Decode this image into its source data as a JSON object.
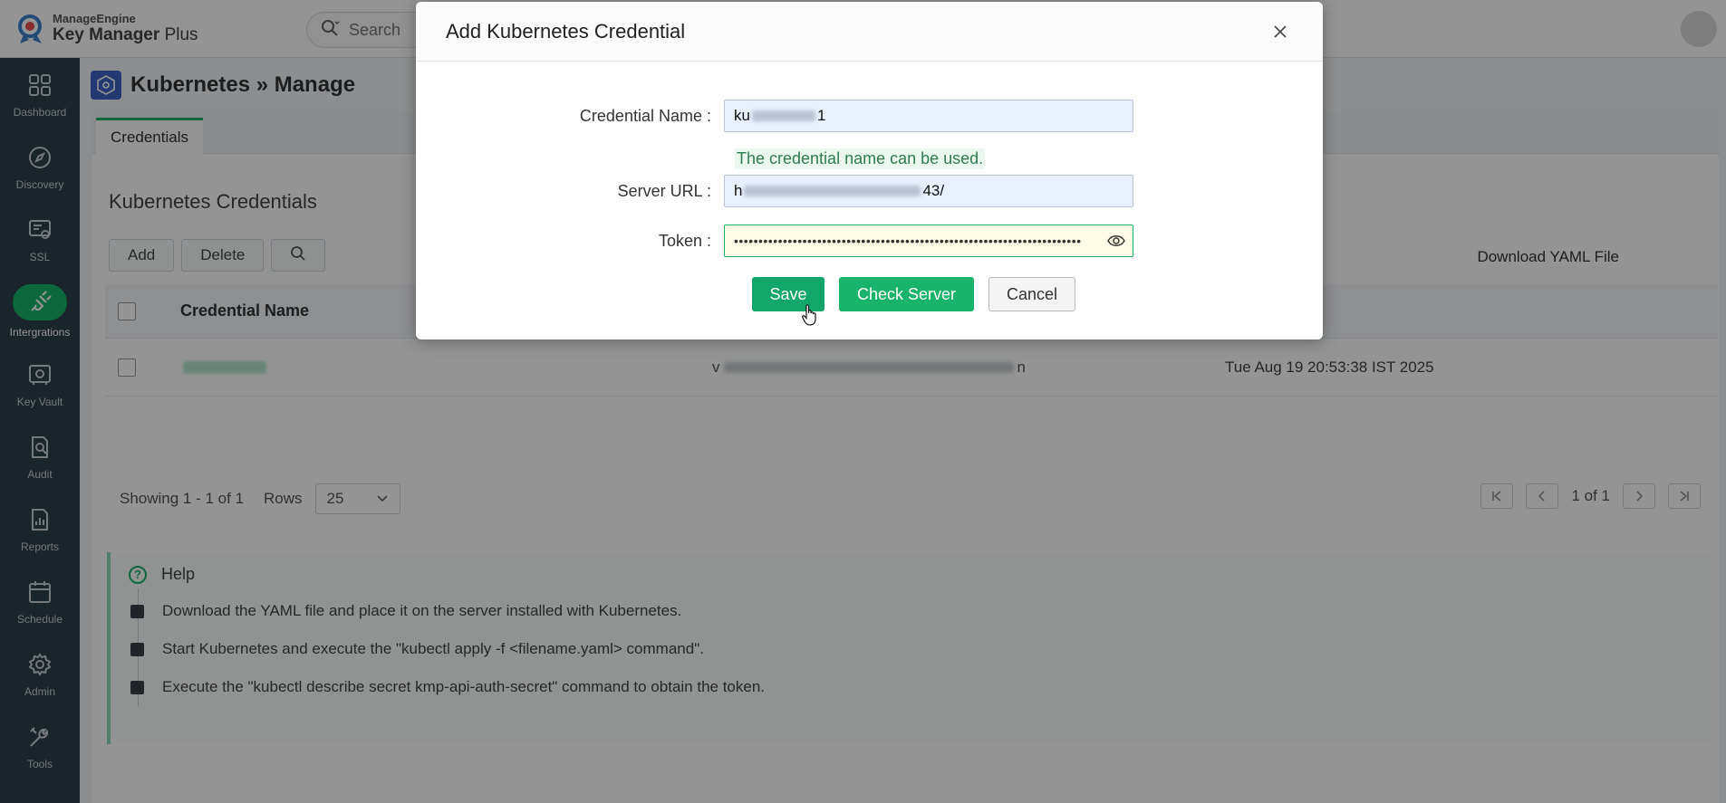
{
  "app": {
    "vendor": "ManageEngine",
    "product_primary": "Key Manager",
    "product_secondary": "Plus",
    "accent_color": "#19b36b",
    "nav_bg_color": "#2e3f4a"
  },
  "search": {
    "placeholder": "Search"
  },
  "nav": {
    "items": [
      {
        "label": "Dashboard",
        "icon": "dashboard-icon"
      },
      {
        "label": "Discovery",
        "icon": "compass-icon"
      },
      {
        "label": "SSL",
        "icon": "certificate-icon"
      },
      {
        "label": "Intergrations",
        "icon": "plug-icon",
        "active": true
      },
      {
        "label": "Key Vault",
        "icon": "vault-icon"
      },
      {
        "label": "Audit",
        "icon": "audit-icon"
      },
      {
        "label": "Reports",
        "icon": "reports-icon"
      },
      {
        "label": "Schedule",
        "icon": "calendar-icon"
      },
      {
        "label": "Admin",
        "icon": "gear-icon"
      },
      {
        "label": "Tools",
        "icon": "tools-icon"
      }
    ]
  },
  "page": {
    "title": "Kubernetes » Manage",
    "tab": "Credentials",
    "section_title": "Kubernetes Credentials",
    "buttons": {
      "add": "Add",
      "delete": "Delete"
    },
    "download_link": "Download YAML File",
    "table": {
      "header_name": "Credential Name",
      "rows": [
        {
          "email_prefix": "v",
          "email_suffix": "n",
          "date": "Tue Aug 19 20:53:38 IST 2025"
        }
      ]
    },
    "pagination": {
      "showing": "Showing 1 - 1 of 1",
      "rows_label": "Rows",
      "rows_value": "25",
      "page_text": "1 of 1"
    },
    "help": {
      "title": "Help",
      "items": [
        "Download the YAML file and place it on the server installed with Kubernetes.",
        "Start Kubernetes and execute the \"kubectl apply -f <filename.yaml> command\".",
        "Execute the \"kubectl describe secret kmp-api-auth-secret\" command to obtain the token."
      ]
    }
  },
  "modal": {
    "title": "Add Kubernetes Credential",
    "credential_name_label": "Credential Name :",
    "credential_name_prefix": "ku",
    "credential_name_suffix": "1",
    "credential_hint": "The credential name can be used.",
    "server_url_label": "Server URL :",
    "server_url_prefix": "h",
    "server_url_suffix": "43/",
    "token_label": "Token :",
    "token_mask": "•••••••••••••••••••••••••••••••••••••••••••••••••••••••••••••••••••••••",
    "buttons": {
      "save": "Save",
      "check_server": "Check Server",
      "cancel": "Cancel"
    }
  }
}
